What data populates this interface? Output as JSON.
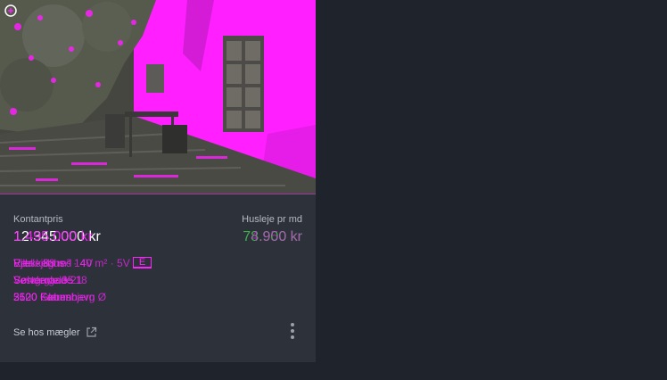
{
  "listing": {
    "price": {
      "label": "Kontantpris",
      "values": [
        "12.345.000 kr",
        "1.495.000 kr"
      ]
    },
    "rent": {
      "label": "Husleje pr md",
      "values": [
        "78.900 kr",
        "4.950 kr"
      ]
    },
    "specs": {
      "line1": [
        "Villa · 88 m² · 4V",
        "Rækkehus · 140 m² · 5V",
        "Ejerlejlighed"
      ],
      "energy_label": "E",
      "line2": [
        "Sølvgade 35",
        "Søndergade 18",
        "Vestergade 21"
      ],
      "line3": [
        "5620 Glamsbjerg",
        "3520 Farum",
        "2100 København Ø"
      ]
    },
    "footer": {
      "broker_link": "Se hos mægler"
    }
  },
  "icons": [
    "logo-icon",
    "external-link-icon",
    "more-vertical-icon"
  ],
  "colors": {
    "page_bg": "#1f232b",
    "card_bg": "#2c313a",
    "accent_magenta": "#ff24ff",
    "rent_green": "#3bb34a",
    "text_muted": "#b6bac2"
  }
}
